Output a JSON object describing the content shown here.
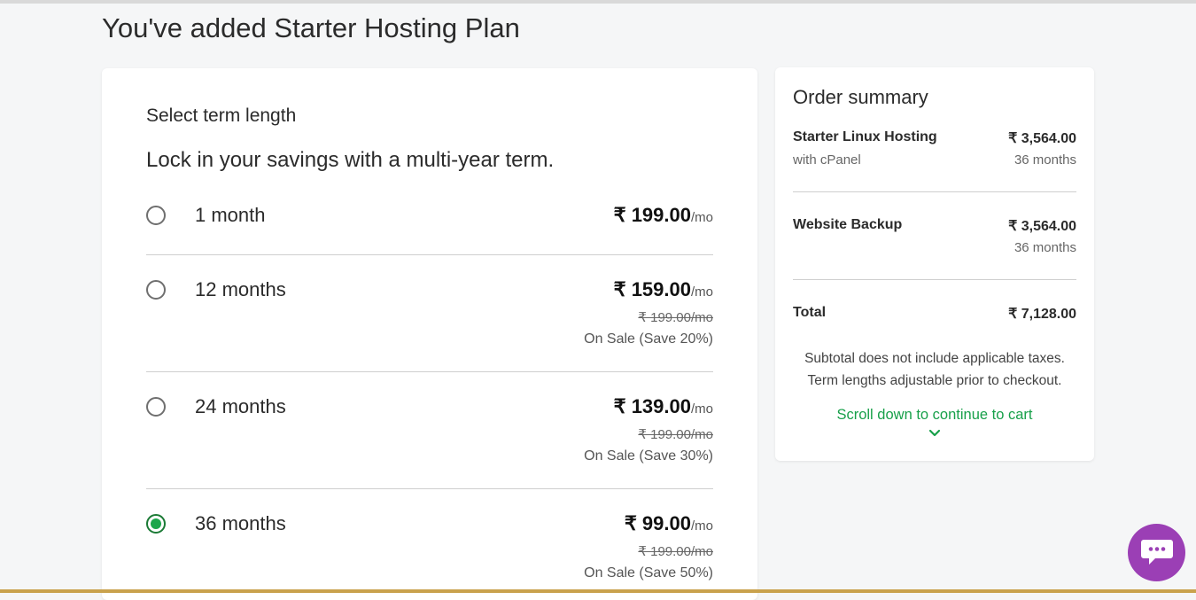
{
  "page": {
    "title": "You've added Starter Hosting Plan"
  },
  "term_selector": {
    "heading": "Select term length",
    "subheading": "Lock in your savings with a multi-year term.",
    "options": [
      {
        "label": "1 month",
        "price": "₹ 199.00",
        "unit": "/mo",
        "original_price": "",
        "sale_text": "",
        "selected": false
      },
      {
        "label": "12 months",
        "price": "₹ 159.00",
        "unit": "/mo",
        "original_price": "₹ 199.00/mo",
        "sale_text": "On Sale (Save 20%)",
        "selected": false
      },
      {
        "label": "24 months",
        "price": "₹ 139.00",
        "unit": "/mo",
        "original_price": "₹ 199.00/mo",
        "sale_text": "On Sale (Save 30%)",
        "selected": false
      },
      {
        "label": "36 months",
        "price": "₹ 99.00",
        "unit": "/mo",
        "original_price": "₹ 199.00/mo",
        "sale_text": "On Sale (Save 50%)",
        "selected": true
      }
    ]
  },
  "order_summary": {
    "title": "Order summary",
    "items": [
      {
        "name": "Starter Linux Hosting",
        "note": "with cPanel",
        "price": "₹ 3,564.00",
        "term": "36 months"
      },
      {
        "name": "Website Backup",
        "note": "",
        "price": "₹ 3,564.00",
        "term": "36 months"
      }
    ],
    "total_label": "Total",
    "total_value": "₹ 7,128.00",
    "disclaimer_line1": "Subtotal does not include applicable taxes.",
    "disclaimer_line2": "Term lengths adjustable prior to checkout.",
    "scroll_text": "Scroll down to continue to cart"
  },
  "colors": {
    "accent_green": "#18a04a",
    "chat_purple": "#9b3fb5"
  },
  "icons": {
    "scroll": "chevron-down-icon",
    "chat": "chat-bubble-icon"
  }
}
